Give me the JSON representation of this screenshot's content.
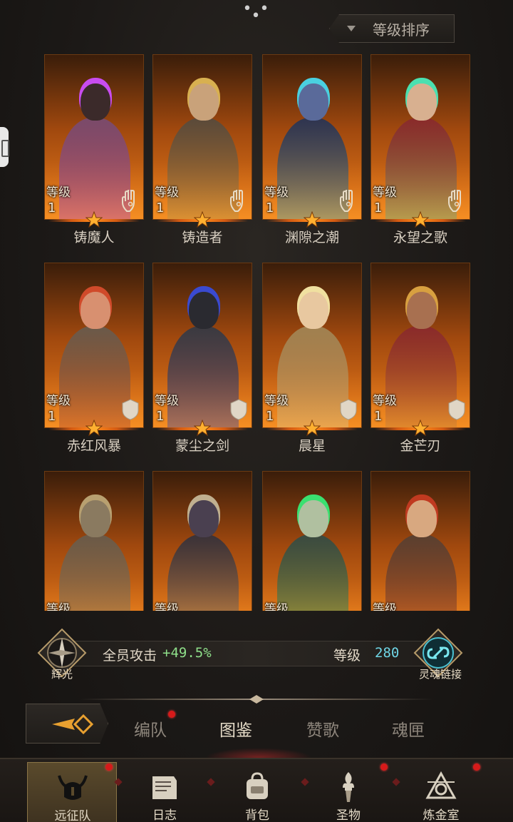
{
  "header": {
    "more_icon": "more-horizontal-icon",
    "sort_label": "等级排序",
    "sort_icon": "caret-down-icon"
  },
  "heroes": [
    {
      "name": "铸魔人",
      "level_label": "等级",
      "level": "1",
      "badge": "hand-icon",
      "theme": {
        "head": "#3b2a2a",
        "body": "#7a4a6a",
        "accent": "#c84cf0"
      }
    },
    {
      "name": "铸造者",
      "level_label": "等级",
      "level": "1",
      "badge": "hand-icon",
      "theme": {
        "head": "#c9a27a",
        "body": "#5a4a3a",
        "accent": "#d8b050"
      }
    },
    {
      "name": "渊隙之潮",
      "level_label": "等级",
      "level": "1",
      "badge": "hand-icon",
      "theme": {
        "head": "#5a6a9a",
        "body": "#2e3450",
        "accent": "#4ad0e0"
      }
    },
    {
      "name": "永望之歌",
      "level_label": "等级",
      "level": "1",
      "badge": "hand-icon",
      "theme": {
        "head": "#d8b090",
        "body": "#8a2a2a",
        "accent": "#4ae0b0"
      }
    },
    {
      "name": "赤红风暴",
      "level_label": "等级",
      "level": "1",
      "badge": "shield-icon",
      "theme": {
        "head": "#d89070",
        "body": "#6a5a4a",
        "accent": "#d04a2a"
      }
    },
    {
      "name": "蒙尘之剑",
      "level_label": "等级",
      "level": "1",
      "badge": "shield-icon",
      "theme": {
        "head": "#2a2a30",
        "body": "#3a3a40",
        "accent": "#3a4ad0"
      }
    },
    {
      "name": "晨星",
      "level_label": "等级",
      "level": "1",
      "badge": "shield-icon",
      "theme": {
        "head": "#e8c8a0",
        "body": "#a08050",
        "accent": "#f0e0a0"
      }
    },
    {
      "name": "金芒刃",
      "level_label": "等级",
      "level": "1",
      "badge": "shield-icon",
      "theme": {
        "head": "#a87050",
        "body": "#8a2a2a",
        "accent": "#d8a040"
      }
    },
    {
      "name": "",
      "level_label": "等级",
      "level": "",
      "badge": "",
      "theme": {
        "head": "#8a7a60",
        "body": "#6a5a48",
        "accent": "#b8a070"
      }
    },
    {
      "name": "",
      "level_label": "等级",
      "level": "",
      "badge": "",
      "theme": {
        "head": "#4a4050",
        "body": "#3a3238",
        "accent": "#c0b090"
      }
    },
    {
      "name": "",
      "level_label": "等级",
      "level": "",
      "badge": "",
      "theme": {
        "head": "#b0c0a0",
        "body": "#3a4a40",
        "accent": "#3ae070"
      }
    },
    {
      "name": "",
      "level_label": "等级",
      "level": "",
      "badge": "",
      "theme": {
        "head": "#d8a880",
        "body": "#5a4030",
        "accent": "#c03a20"
      }
    }
  ],
  "bonus": {
    "left_emblem_icon": "radiance-compass-icon",
    "left_caption": "辉光",
    "attack_label": "全员攻击",
    "attack_value": "+49.5%",
    "level_label": "等级",
    "level_value": "280",
    "right_emblem_icon": "soul-link-icon",
    "right_caption": "灵魂链接"
  },
  "subtabs": {
    "back_icon": "back-arrow-icon",
    "items": [
      {
        "label": "编队",
        "has_dot": true
      },
      {
        "label": "图鉴",
        "active": true
      },
      {
        "label": "赞歌"
      },
      {
        "label": "魂匣"
      }
    ]
  },
  "nav": [
    {
      "label": "远征队",
      "icon": "horned-helmet-icon",
      "active": true,
      "has_dot": true
    },
    {
      "label": "日志",
      "icon": "journal-icon"
    },
    {
      "label": "背包",
      "icon": "backpack-icon"
    },
    {
      "label": "圣物",
      "icon": "torch-icon",
      "has_dot": true
    },
    {
      "label": "炼金室",
      "icon": "alchemy-icon",
      "has_dot": true
    }
  ],
  "colors": {
    "accent_green": "#8fe08a",
    "accent_cyan": "#6fd6e6",
    "card_orange": "#d06a16",
    "notification_red": "#d61a1a"
  }
}
